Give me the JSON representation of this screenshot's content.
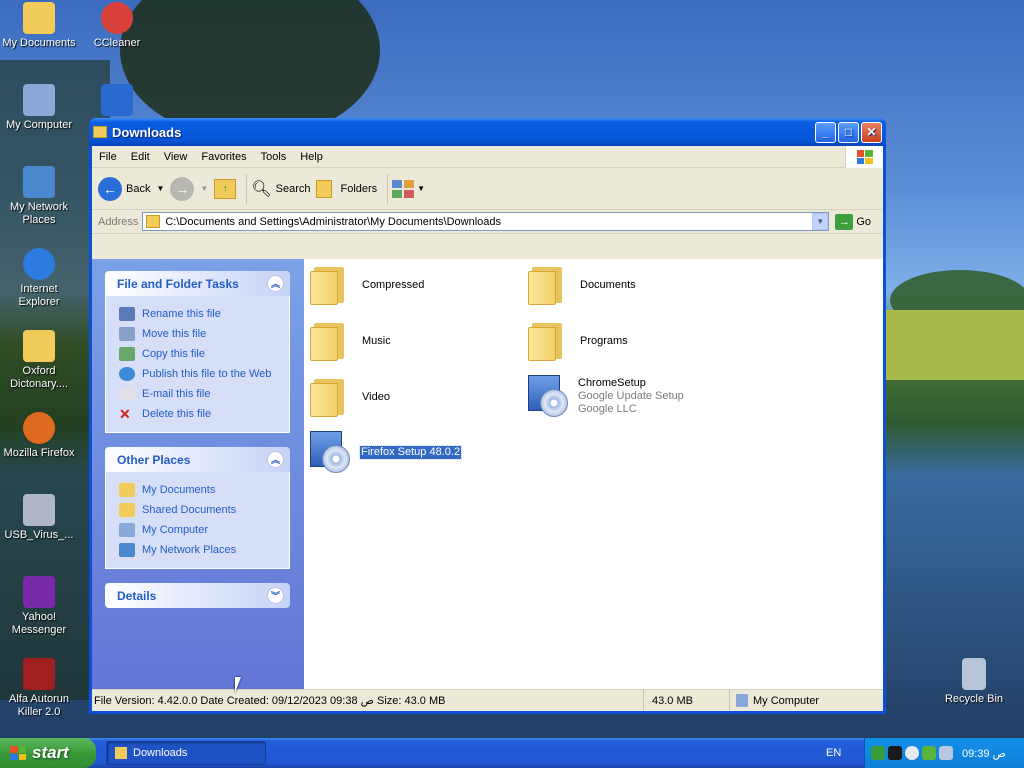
{
  "desktop_icons": [
    {
      "label": "My Documents",
      "color": "#f2cc5a"
    },
    {
      "label": "CCleaner",
      "color": "#d8403a"
    },
    {
      "label": "My Computer",
      "color": "#8aa8d8"
    },
    {
      "label": "My Network Places",
      "color": "#4a88d0"
    },
    {
      "label": "Internet Explorer",
      "color": "#2b7be0"
    },
    {
      "label": "Oxford Dictonary....",
      "color": "#f2cc5a"
    },
    {
      "label": "Mozilla Firefox",
      "color": "#e06a20"
    },
    {
      "label": "USB_Virus_...",
      "color": "#b0b8c8"
    },
    {
      "label": "Yahoo! Messenger",
      "color": "#7a2aa8"
    },
    {
      "label": "Alfa Autorun Killer 2.0",
      "color": "#a02020"
    },
    {
      "label": "Recycle Bin",
      "color": "#b8c4d8"
    }
  ],
  "window": {
    "title": "Downloads",
    "menu": [
      "File",
      "Edit",
      "View",
      "Favorites",
      "Tools",
      "Help"
    ],
    "toolbar": {
      "back": "Back",
      "search": "Search",
      "folders": "Folders"
    },
    "address": {
      "label": "Address",
      "path": "C:\\Documents and Settings\\Administrator\\My Documents\\Downloads",
      "go": "Go"
    },
    "tasks": {
      "file_folder_title": "File and Folder Tasks",
      "file_folder_items": [
        "Rename this file",
        "Move this file",
        "Copy this file",
        "Publish this file to the Web",
        "E-mail this file",
        "Delete this file"
      ],
      "other_places_title": "Other Places",
      "other_places_items": [
        "My Documents",
        "Shared Documents",
        "My Computer",
        "My Network Places"
      ],
      "details_title": "Details"
    },
    "files": [
      {
        "name": "Compressed"
      },
      {
        "name": "Documents"
      },
      {
        "name": "Music"
      },
      {
        "name": "Programs"
      },
      {
        "name": "Video"
      },
      {
        "name": "ChromeSetup",
        "sub1": "Google Update Setup",
        "sub2": "Google LLC"
      },
      {
        "name": "Firefox Setup 48.0.2"
      }
    ],
    "status": {
      "info": "File Version: 4.42.0.0 Date Created: 09/12/2023 09:38 ص Size: 43.0 MB",
      "size": "43.0 MB",
      "zone": "My Computer"
    }
  },
  "taskbar": {
    "start": "start",
    "task": "Downloads",
    "lang": "EN",
    "clock": "09:39 ص"
  },
  "colors": {
    "accent": "#215dc6",
    "selection": "#316ac5",
    "titlebar": "#0554d6"
  }
}
